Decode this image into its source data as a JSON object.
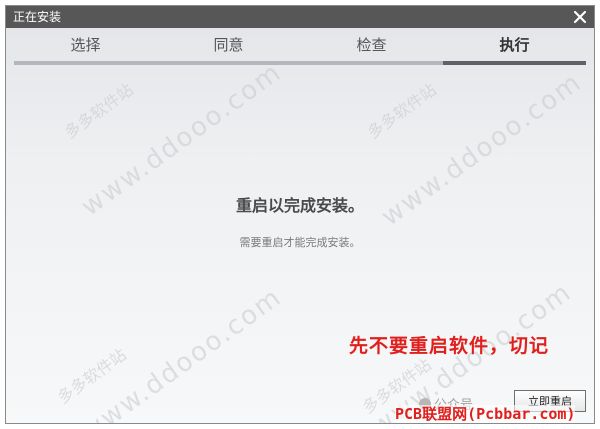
{
  "window": {
    "title": "正在安装"
  },
  "steps": [
    {
      "label": "选择",
      "active": false
    },
    {
      "label": "同意",
      "active": false
    },
    {
      "label": "检查",
      "active": false
    },
    {
      "label": "执行",
      "active": true
    }
  ],
  "main": {
    "message": "重启以完成安装。",
    "sub_message": "需要重启才能完成安装。"
  },
  "annotation": "先不要重启软件，切记",
  "buttons": {
    "restart_now": "立即重启"
  },
  "watermarks": {
    "site": "www.ddooo.com",
    "site_cn": "多多软件站",
    "wechat": "公众号",
    "footer": "PCB联盟网(Pcbbar.com)"
  },
  "colors": {
    "titlebar": "#575757",
    "annotation": "#e0201c",
    "active_step_bar": "#5e6166",
    "inactive_step_bar": "#b3b6ba"
  }
}
